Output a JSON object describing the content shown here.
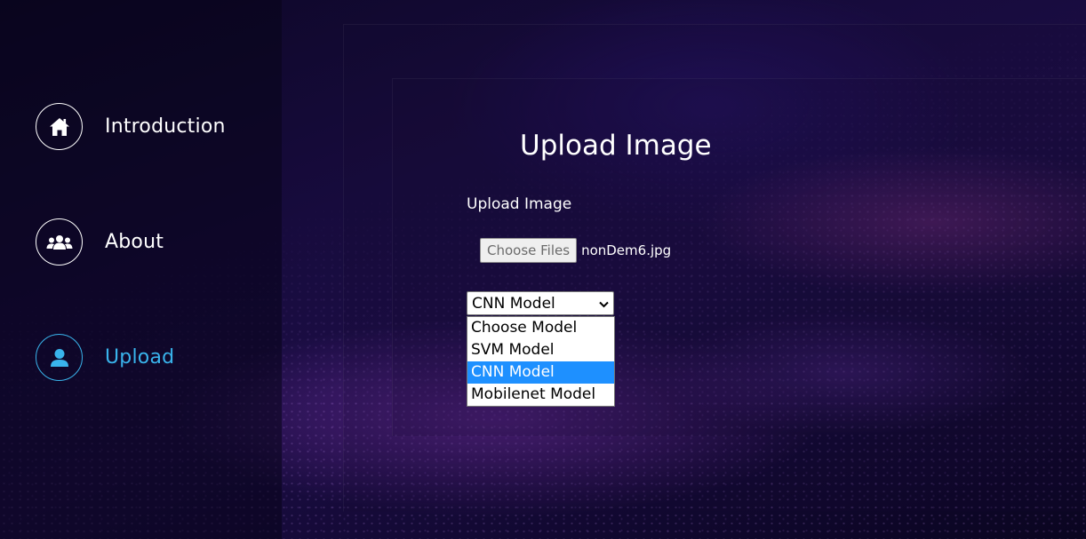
{
  "colors": {
    "accent": "#39b4ec",
    "highlight": "#1e90ff",
    "text": "#ffffff"
  },
  "sidebar": {
    "items": [
      {
        "label": "Introduction",
        "icon": "home-icon",
        "active": false
      },
      {
        "label": "About",
        "icon": "users-icon",
        "active": false
      },
      {
        "label": "Upload",
        "icon": "user-icon",
        "active": true
      }
    ]
  },
  "main": {
    "title": "Upload Image",
    "upload_label": "Upload Image",
    "file_button": "Choose Files",
    "file_name": "nonDem6.jpg",
    "model_select": {
      "selected": "CNN Model",
      "options": [
        "Choose Model",
        "SVM Model",
        "CNN Model",
        "Mobilenet Model"
      ],
      "highlighted_index": 2
    }
  }
}
